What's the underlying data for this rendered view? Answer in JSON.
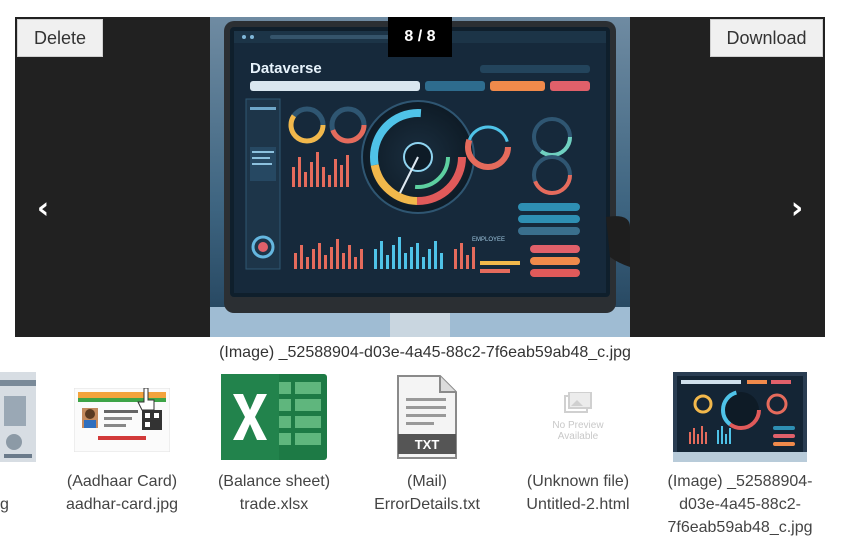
{
  "viewer": {
    "counter": "8 / 8",
    "delete_label": "Delete",
    "download_label": "Download",
    "prev_icon": "chevron-left-icon",
    "next_icon": "chevron-right-icon",
    "prev_glyph": "‹",
    "next_glyph": "›",
    "image": {
      "brand": "Dataverse",
      "sub_label": "EMPLOYEE"
    },
    "caption": "(Image) _52588904-d03e-4a45-88c2-7f6eab59ab48_c.jpg"
  },
  "thumbnails": [
    {
      "type": "partial",
      "line1": "",
      "line2": "g"
    },
    {
      "type": "Aadhaar Card",
      "line1": "(Aadhaar Card)",
      "line2": "aadhar-card.jpg"
    },
    {
      "type": "Balance sheet",
      "line1": "(Balance sheet)",
      "line2": "trade.xlsx"
    },
    {
      "type": "Mail",
      "line1": "(Mail)",
      "line2": "ErrorDetails.txt",
      "badge": "TXT"
    },
    {
      "type": "Unknown file",
      "line1": "(Unknown file)",
      "line2": "Untitled-2.html",
      "no_preview": "No Preview Available"
    },
    {
      "type": "Image",
      "line1": "(Image) _52588904-",
      "line2": "d03e-4a45-88c2-",
      "line3": "7f6eab59ab48_c.jpg"
    }
  ],
  "colors": {
    "viewer_bg": "#212121",
    "excel_green": "#1d7a45",
    "dashboard_bg": "#16293b"
  }
}
